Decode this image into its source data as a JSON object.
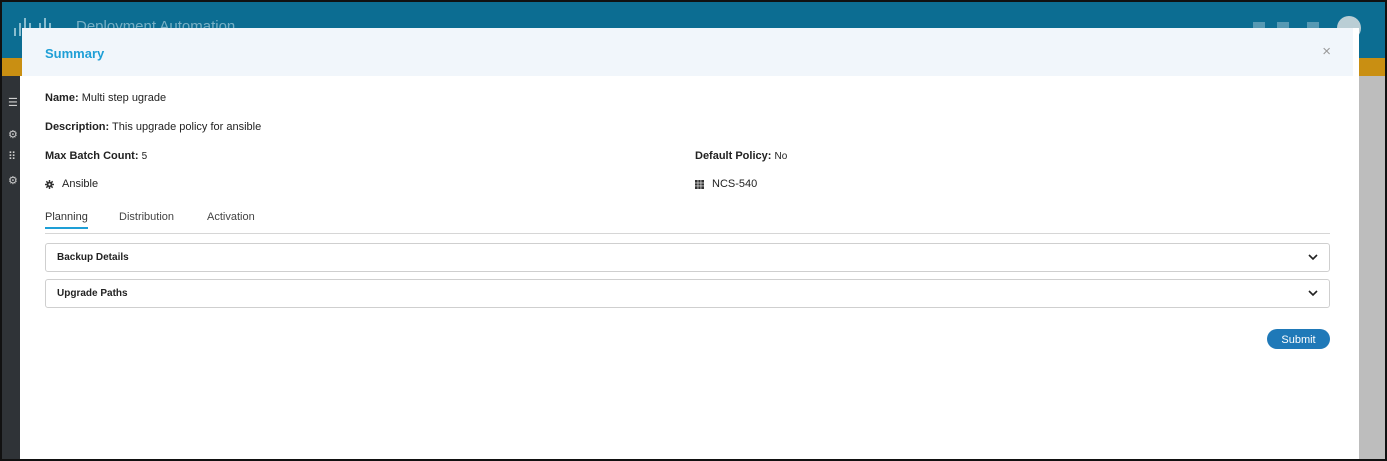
{
  "app": {
    "title": "Deployment Automation"
  },
  "modal": {
    "title": "Summary",
    "close_symbol": "×",
    "name_label": "Name:",
    "name_value": "Multi step ugrade",
    "description_label": "Description:",
    "description_value": "This upgrade policy for ansible",
    "max_batch_label": "Max Batch Count:",
    "max_batch_value": "5",
    "default_policy_label": "Default Policy:",
    "default_policy_value": "No",
    "platform_tag": {
      "icon": "gear-icon",
      "label": "Ansible"
    },
    "device_tag": {
      "icon": "grid-icon",
      "label": "NCS-540"
    },
    "tabs": [
      {
        "label": "Planning",
        "active": true
      },
      {
        "label": "Distribution",
        "active": false
      },
      {
        "label": "Activation",
        "active": false
      }
    ],
    "accordions": [
      {
        "label": "Backup Details",
        "icon": "chevron-down-icon"
      },
      {
        "label": "Upgrade Paths",
        "icon": "chevron-down-icon"
      }
    ],
    "submit_label": "Submit"
  },
  "colors": {
    "header_bg": "#0c6d92",
    "accent": "#1e9fd6",
    "button": "#1f79b8",
    "stripe": "#c98f12"
  }
}
